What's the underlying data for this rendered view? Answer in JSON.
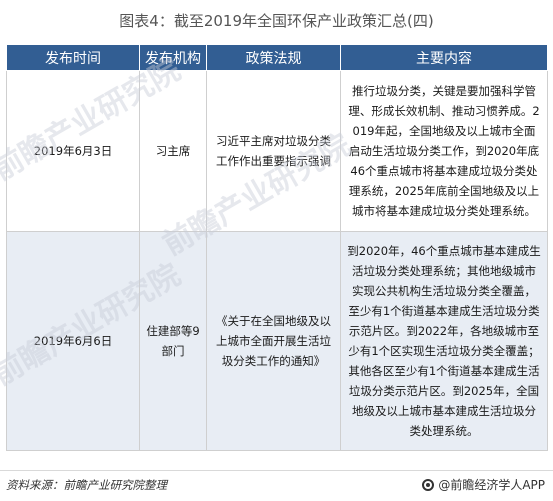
{
  "title": "图表4：截至2019年全国环保产业政策汇总(四)",
  "table": {
    "headers": [
      "发布时间",
      "发布机构",
      "政策法规",
      "主要内容"
    ],
    "rows": [
      {
        "date": "2019年6月3日",
        "agency": "习主席",
        "policy": "习近平主席对垃圾分类工作作出重要指示强调",
        "content": "推行垃圾分类，关键是要加强科学管理、形成长效机制、推动习惯养成。2019年起，全国地级及以上城市全面启动生活垃圾分类工作，到2020年底46个重点城市将基本建成垃圾分类处理系统，2025年底前全国地级及以上城市将基本建成垃圾分类处理系统。"
      },
      {
        "date": "2019年6月6日",
        "agency": "住建部等9部门",
        "policy": "《关于在全国地级及以上城市全面开展生活垃圾分类工作的通知》",
        "content": "到2020年，46个重点城市基本建成生活垃圾分类处理系统；其他地级城市实现公共机构生活垃圾分类全覆盖，至少有1个街道基本建成生活垃圾分类示范片区。到2022年，各地级城市至少有1个区实现生活垃圾分类全覆盖；其他各区至少有1个街道基本建成生活垃圾分类示范片区。到2025年，全国地级及以上城市基本建成生活垃圾分类处理系统。"
      }
    ]
  },
  "footer": {
    "source": "资料来源：前瞻产业研究院整理",
    "brand": "@前瞻经济学人APP"
  },
  "watermarks": [
    "前瞻产业研究院",
    "前瞻产业研究院",
    "前瞻产业研究院"
  ]
}
